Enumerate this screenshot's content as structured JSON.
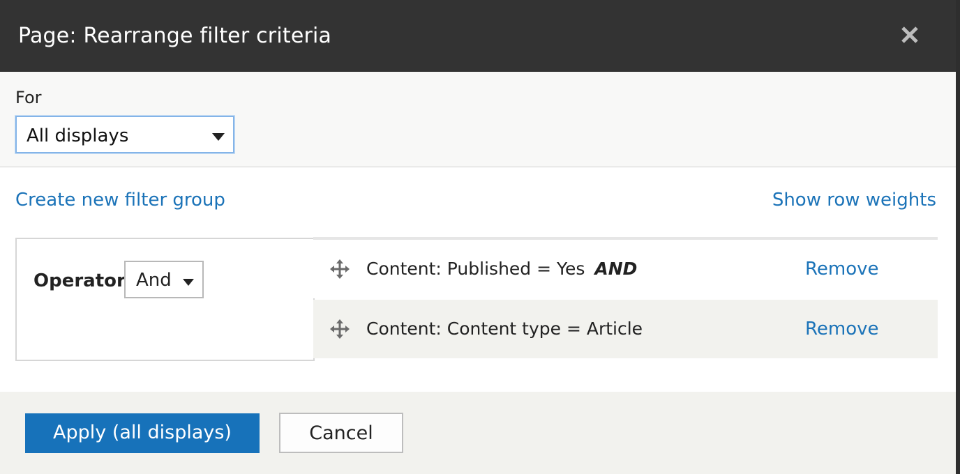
{
  "dialog": {
    "title": "Page: Rearrange filter criteria",
    "close_icon": "close-icon"
  },
  "for_section": {
    "label": "For",
    "selected": "All displays"
  },
  "links": {
    "create_group": "Create new filter group",
    "show_weights": "Show row weights"
  },
  "group": {
    "operator_label": "Operator:",
    "operator_value": "And",
    "filters": [
      {
        "label": "Content: Published = Yes",
        "operator": "AND",
        "remove": "Remove"
      },
      {
        "label": "Content: Content type = Article",
        "operator": "",
        "remove": "Remove"
      }
    ]
  },
  "footer": {
    "apply_label": "Apply (all displays)",
    "cancel_label": "Cancel"
  },
  "colors": {
    "titlebar": "#333333",
    "link": "#1b73b8",
    "primary_button": "#1772ba",
    "footer_bg": "#f2f2ee"
  }
}
